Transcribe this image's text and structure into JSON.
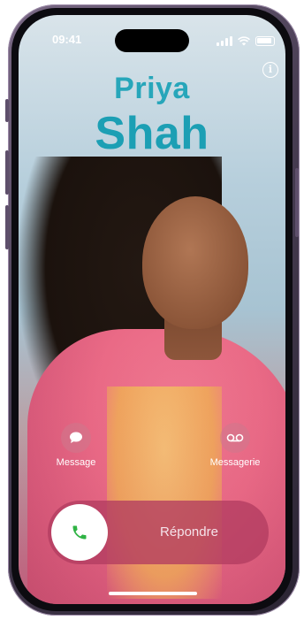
{
  "status_bar": {
    "time": "09:41"
  },
  "caller": {
    "first_name": "Priya",
    "last_name": "Shah"
  },
  "actions": {
    "message": {
      "label": "Message",
      "icon": "speech-bubble-icon"
    },
    "voicemail": {
      "label": "Messagerie",
      "icon": "voicemail-icon"
    }
  },
  "answer": {
    "label": "Répondre",
    "icon": "phone-icon"
  },
  "info": {
    "icon": "info-icon"
  },
  "colors": {
    "name": "#27a6ba",
    "answer_slider": "#b23c60",
    "answer_icon": "#2fb344"
  }
}
